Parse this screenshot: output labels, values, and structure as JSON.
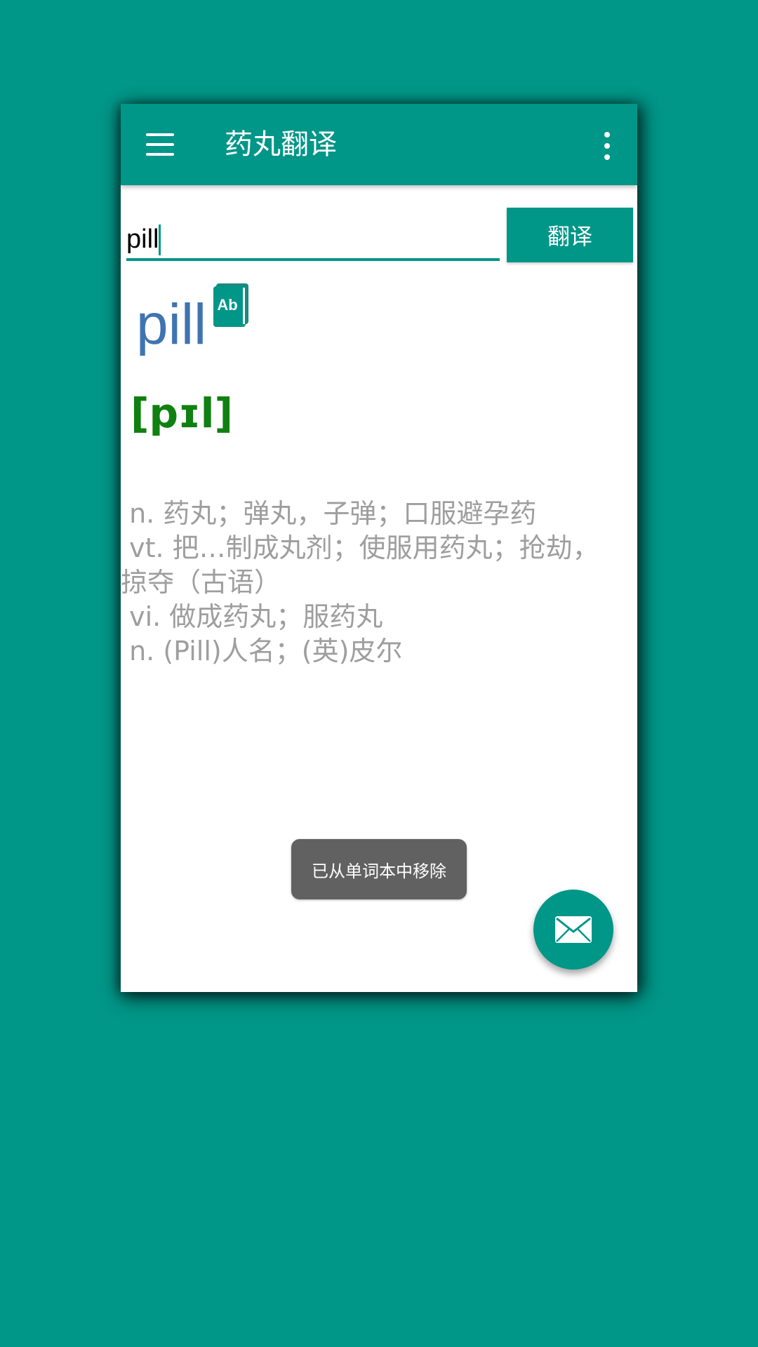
{
  "app_bar": {
    "title": "药丸翻译",
    "menu_icon": "hamburger-menu-icon",
    "more_icon": "more-vert-icon"
  },
  "search": {
    "value": "pill",
    "button_label": "翻译"
  },
  "result": {
    "word": "pill",
    "word_icon": "wordbook-icon",
    "phonetic": "[pɪl]",
    "definitions": [
      " n. 药丸；弹丸，子弹；口服避孕药",
      " vt. 把…制成丸剂；使服用药丸；抢劫，掠夺（古语）",
      " vi. 做成药丸；服药丸",
      " n. (Pill)人名；(英)皮尔"
    ]
  },
  "toast": {
    "message": "已从单词本中移除"
  },
  "fab": {
    "icon": "mail-icon"
  },
  "colors": {
    "primary": "#009688",
    "word": "#3f74b1",
    "phonetic": "#108010",
    "definition_text": "#9e9e9e",
    "toast_bg": "#616161"
  }
}
